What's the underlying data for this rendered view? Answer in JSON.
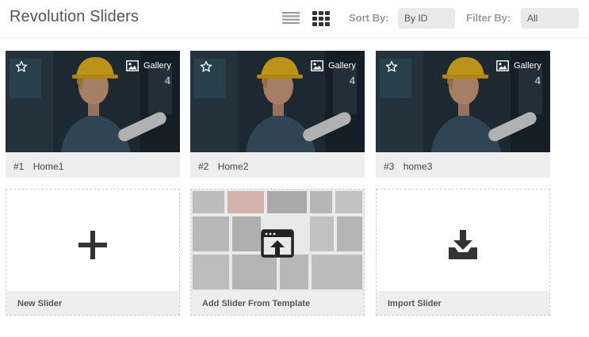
{
  "header": {
    "title": "Revolution Sliders",
    "sort_label": "Sort By:",
    "sort_value": "By ID",
    "filter_label": "Filter By:",
    "filter_value": "All"
  },
  "sliders": [
    {
      "number": "#1",
      "name": "Home1",
      "type": "Gallery",
      "count": "4"
    },
    {
      "number": "#2",
      "name": "Home2",
      "type": "Gallery",
      "count": "4"
    },
    {
      "number": "#3",
      "name": "home3",
      "type": "Gallery",
      "count": "4"
    }
  ],
  "actions": {
    "new_slider": "New Slider",
    "add_template": "Add Slider From Template",
    "import_slider": "Import Slider"
  },
  "icons": {
    "list_view": "list-view-icon",
    "grid_view": "grid-view-icon",
    "star": "star-icon",
    "gallery": "image-icon",
    "plus": "plus-icon",
    "template_upload": "browser-upload-icon",
    "import": "download-tray-icon"
  },
  "colors": {
    "text_dark": "#333333",
    "muted_label": "#9a9a9a",
    "footer_bg": "#eeeeee",
    "select_bg": "#e9e9e9"
  }
}
